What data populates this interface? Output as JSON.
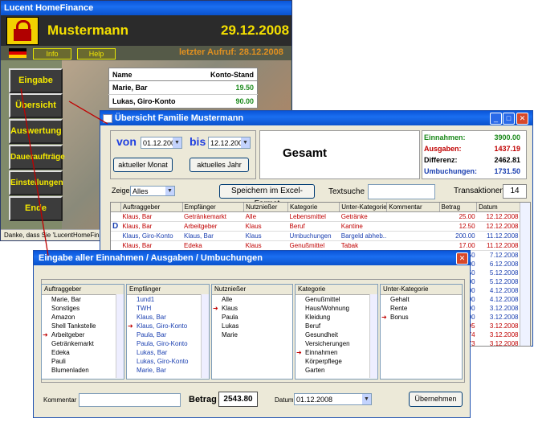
{
  "main_window": {
    "title": "Lucent HomeFinance",
    "user_name": "Mustermann",
    "date": "29.12.2008",
    "last_call": "letzter Aufruf: 28.12.2008",
    "info_label": "Info",
    "help_label": "Help",
    "nav": [
      "Eingabe",
      "Übersicht",
      "Auswertung",
      "Daueraufträge",
      "Einstellungen",
      "Ende"
    ],
    "account_table": {
      "headers": [
        "Name",
        "Konto-Stand"
      ],
      "rows": [
        {
          "name": "Marie, Bar",
          "value": "19.50"
        },
        {
          "name": "Lukas, Giro-Konto",
          "value": "90.00"
        }
      ]
    },
    "status": "Danke, dass Sie 'LucentHomeFinance'"
  },
  "overview_window": {
    "title": "Übersicht Familie Mustermann",
    "von_label": "von",
    "von_value": "01.12.2008",
    "bis_label": "bis",
    "bis_value": "12.12.2008",
    "month_button": "aktueller Monat",
    "year_button": "aktuelles Jahr",
    "gesamt": "Gesamt",
    "summary": [
      {
        "label": "Einnahmen:",
        "value": "3900.00",
        "color": "#1c8a1c"
      },
      {
        "label": "Ausgaben:",
        "value": "1437.19",
        "color": "#c00000"
      },
      {
        "label": "Differenz:",
        "value": "2462.81",
        "color": "#000000"
      },
      {
        "label": "Umbuchungen:",
        "value": "1731.50",
        "color": "#1a3fb0"
      }
    ],
    "zeige_label": "Zeige",
    "zeige_value": "Alles",
    "excel_button": "Speichern im Excel-Format",
    "textsuche_label": "Textsuche",
    "transaktionen_label": "Transaktionen",
    "transaktionen_count": "14",
    "columns": [
      "",
      "Auftraggeber",
      "Empfänger",
      "Nutznießer",
      "Kategorie",
      "Unter-Kategorie",
      "Kommentar",
      "Betrag",
      "Datum"
    ],
    "rows": [
      {
        "marker": "",
        "a": "Klaus, Bar",
        "e": "Getränkemarkt",
        "n": "Alle",
        "k": "Lebensmittel",
        "u": "Getränke",
        "c": "",
        "b": "25.00",
        "d": "12.12.2008",
        "color": "#c00000"
      },
      {
        "marker": "D",
        "a": "Klaus, Bar",
        "e": "Arbeitgeber",
        "n": "Klaus",
        "k": "Beruf",
        "u": "Kantine",
        "c": "",
        "b": "12.50",
        "d": "12.12.2008",
        "color": "#c00000"
      },
      {
        "marker": "",
        "a": "Klaus, Giro-Konto",
        "e": "Klaus, Bar",
        "n": "Klaus",
        "k": "Umbuchungen",
        "u": "Bargeld abheb...",
        "c": "",
        "b": "200.00",
        "d": "11.12.2008",
        "color": "#1a3fb0"
      },
      {
        "marker": "",
        "a": "Klaus, Bar",
        "e": "Edeka",
        "n": "Klaus",
        "k": "Genußmittel",
        "u": "Tabak",
        "c": "",
        "b": "17.00",
        "d": "11.12.2008",
        "color": "#c00000"
      }
    ],
    "peek_amounts": [
      "50",
      "00",
      "50",
      "00",
      "00",
      "00",
      "00",
      "00",
      "95",
      "74",
      "73"
    ],
    "peek_dates": [
      "7.12.2008",
      "6.12.2008",
      "5.12.2008",
      "5.12.2008",
      "4.12.2008",
      "4.12.2008",
      "3.12.2008",
      "3.12.2008",
      "3.12.2008",
      "3.12.2008",
      "3.12.2008"
    ]
  },
  "input_window": {
    "title": "Eingabe aller Einnahmen / Ausgaben / Umbuchungen",
    "lists": [
      {
        "header": "Auftraggeber",
        "items": [
          "Marie, Bar",
          "Sonstiges",
          "Amazon",
          "Shell Tankstelle",
          "Arbeitgeber",
          "Getränkemarkt",
          "Edeka",
          "Pauli",
          "Blumenladen"
        ],
        "selected": 4,
        "item_color": "#000000"
      },
      {
        "header": "Empfänger",
        "items": [
          "1und1",
          "TWH",
          "Klaus, Bar",
          "Klaus, Giro-Konto",
          "Paula, Bar",
          "Paula, Giro-Konto",
          "Lukas, Bar",
          "Lukas, Giro-Konto",
          "Marie, Bar"
        ],
        "selected": 3,
        "item_color": "#1a3fb0"
      },
      {
        "header": "Nutznießer",
        "items": [
          "Alle",
          "Klaus",
          "Paula",
          "Lukas",
          "Marie"
        ],
        "selected": 1,
        "item_color": "#000000"
      },
      {
        "header": "Kategorie",
        "items": [
          "Genußmittel",
          "Haus/Wohnung",
          "Kleidung",
          "Beruf",
          "Gesundheit",
          "Versicherungen",
          "Einnahmen",
          "Körperpflege",
          "Garten"
        ],
        "selected": 6,
        "item_color": "#000000"
      },
      {
        "header": "Unter-Kategorie",
        "items": [
          "Gehalt",
          "Rente",
          "Bonus"
        ],
        "selected": 2,
        "item_color": "#000000"
      }
    ],
    "kommentar_label": "Kommentar",
    "betrag_label": "Betrag",
    "betrag_value": "2543.80",
    "datum_label": "Datum",
    "datum_value": "01.12.2008",
    "submit_label": "Übernehmen"
  }
}
